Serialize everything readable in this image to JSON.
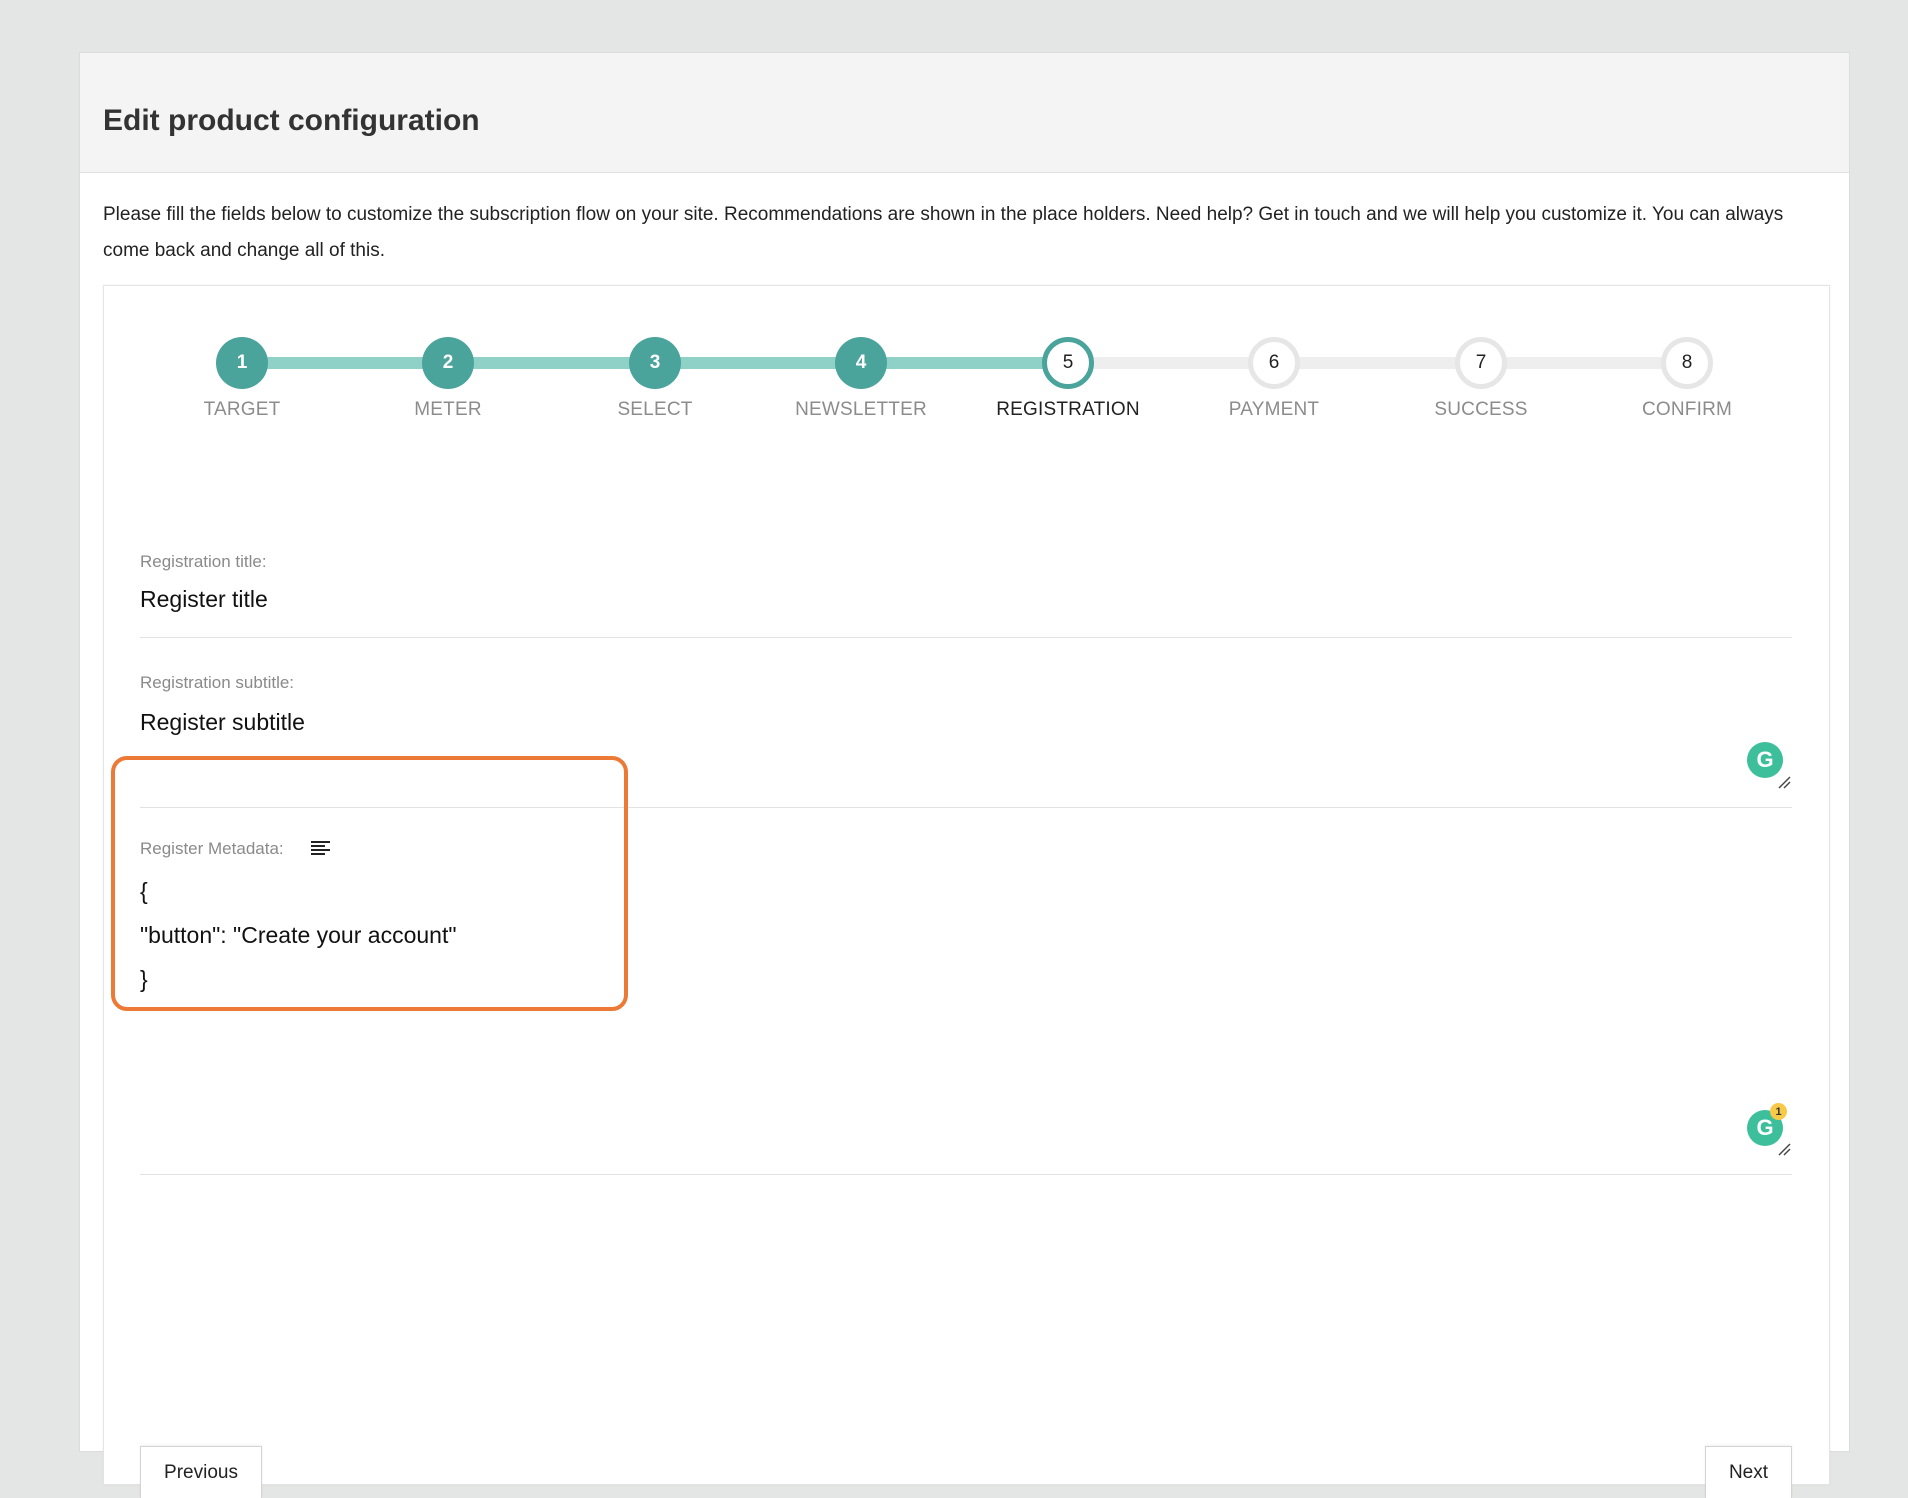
{
  "header": {
    "title": "Edit product configuration"
  },
  "intro": "Please fill the fields below to customize the subscription flow on your site. Recommendations are shown in the place holders. Need help? Get in touch and we will help you customize it. You can always come back and change all of this.",
  "stepper": {
    "steps": [
      {
        "number": "1",
        "label": "TARGET",
        "state": "done"
      },
      {
        "number": "2",
        "label": "METER",
        "state": "done"
      },
      {
        "number": "3",
        "label": "SELECT",
        "state": "done"
      },
      {
        "number": "4",
        "label": "NEWSLETTER",
        "state": "done"
      },
      {
        "number": "5",
        "label": "REGISTRATION",
        "state": "active"
      },
      {
        "number": "6",
        "label": "PAYMENT",
        "state": "todo"
      },
      {
        "number": "7",
        "label": "SUCCESS",
        "state": "todo"
      },
      {
        "number": "8",
        "label": "CONFIRM",
        "state": "todo"
      }
    ]
  },
  "form": {
    "title_label": "Registration title:",
    "title_value": "Register title",
    "subtitle_label": "Registration subtitle:",
    "subtitle_value": "Register subtitle",
    "metadata_label": "Register Metadata:",
    "metadata_lines": [
      "{",
      "\"button\": \"Create your account\"",
      "}"
    ]
  },
  "grammarly": {
    "badge_count": "1"
  },
  "nav": {
    "previous_label": "Previous",
    "next_label": "Next"
  },
  "colors": {
    "accent": "#4aa49c",
    "track_done": "#8fd1c6",
    "highlight": "#ec7a36",
    "grammarly": "#3dbf9c"
  }
}
